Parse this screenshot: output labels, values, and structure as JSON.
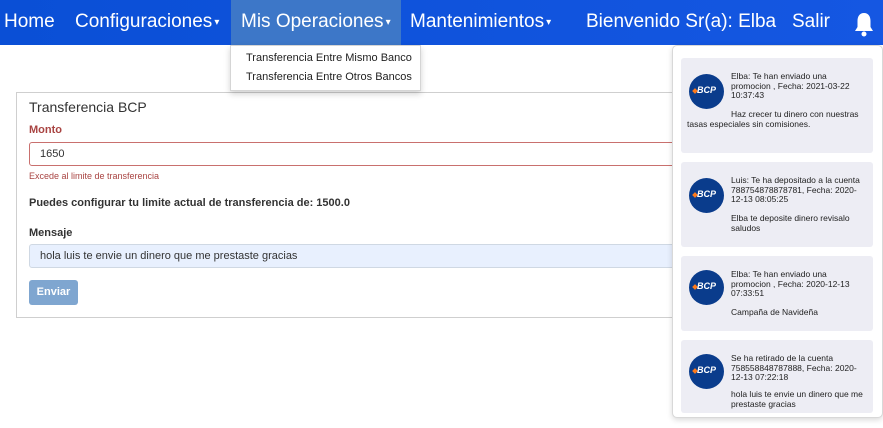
{
  "nav": {
    "home": "Home",
    "configuraciones": "Configuraciones",
    "operaciones": "Mis Operaciones",
    "mantenimientos": "Mantenimientos",
    "welcome": "Bienvenido Sr(a): Elba",
    "salir": "Salir",
    "caret": "▾"
  },
  "dropdown": {
    "items": [
      "Transferencia Entre Mismo Banco",
      "Transferencia Entre Otros Bancos"
    ]
  },
  "form": {
    "title": "Transferencia BCP",
    "monto_label": "Monto",
    "monto_value": "1650",
    "error": "Excede al limite de transferencia",
    "limit_text": "Puedes configurar tu limite actual de transferencia de: 1500.0",
    "mensaje_label": "Mensaje",
    "mensaje_value": "hola luis te envie un dinero que me prestaste gracias",
    "enviar": "Enviar"
  },
  "notifications": {
    "logo_text": "BCP",
    "items": [
      {
        "head": "Elba: Te han enviado una promocion , Fecha: 2021-03-22 10:37:43",
        "body": "Haz crecer tu dinero con nuestras tasas especiales sin comisiones."
      },
      {
        "head": "Luis: Te ha depositado a la cuenta 788754878878781, Fecha: 2020-12-13 08:05:25",
        "body": "Elba te deposite dinero revisalo saludos"
      },
      {
        "head": "Elba: Te han enviado una promocion , Fecha: 2020-12-13 07:33:51",
        "body": "Campaña de Navideña"
      },
      {
        "head": "Se ha retirado de la cuenta 758558848787888, Fecha: 2020-12-13 07:22:18",
        "body": "hola luis te envie un dinero que me prestaste gracias"
      }
    ]
  }
}
